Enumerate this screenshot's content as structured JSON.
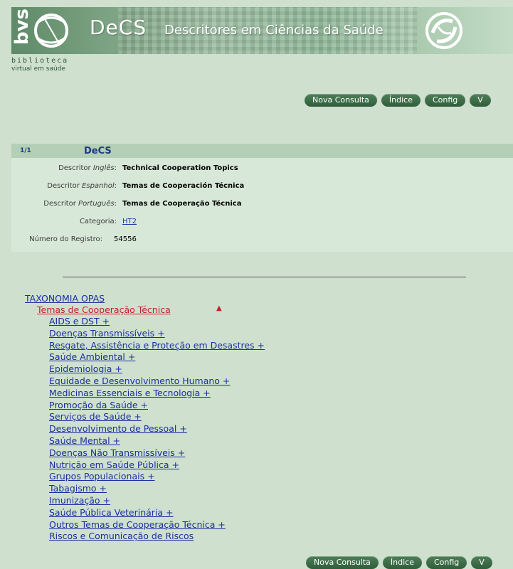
{
  "header": {
    "bvs": "bvs",
    "title": "DeCS",
    "subtitle": "Descritores em Ciências da Saúde",
    "biblioteca": "biblioteca",
    "virtual": "virtual em saúde"
  },
  "toolbar_top": {
    "nova_consulta": "Nova Consulta",
    "indice": "Índice",
    "config": "Config",
    "v": "V"
  },
  "toolbar_bottom": {
    "nova_consulta": "Nova Consulta",
    "indice": "Índice",
    "config": "Config",
    "v": "V"
  },
  "record": {
    "count": "1/1",
    "db": "DeCS",
    "descritor_ingles_prefix": "Descritor ",
    "descritor_ingles_lang": "Inglês",
    "descritor_ingles_value": "Technical Cooperation Topics",
    "descritor_espanhol_prefix": "Descritor ",
    "descritor_espanhol_lang": "Espanhol",
    "descritor_espanhol_value": "Temas de Cooperación Técnica",
    "descritor_portugues_prefix": "Descritor ",
    "descritor_portugues_lang": "Português",
    "descritor_portugues_value": "Temas de Cooperação Técnica",
    "categoria_label": "Categoria:",
    "categoria_value": "HT2",
    "registro_label": "Número do Registro:",
    "registro_value": "54556"
  },
  "tree": {
    "root": "TAXONOMIA OPAS",
    "current": "Temas de Cooperação Técnica",
    "arrow": "▲",
    "children": [
      "AIDS e DST +",
      "Doenças Transmissíveis +",
      "Resgate, Assistência e Proteção em Desastres +",
      "Saúde Ambiental +",
      "Epidemiologia +",
      "Equidade e Desenvolvimento Humano +",
      "Medicinas Essenciais e Tecnologia +",
      "Promoção da Saúde +",
      "Serviços de Saúde +",
      "Desenvolvimento de Pessoal +",
      "Saúde Mental +",
      "Doenças Não Transmissíveis +",
      "Nutrição em Saúde Pública +",
      "Grupos Populacionais +",
      "Tabagismo +",
      "Imunização +",
      "Saúde Pública Veterinária +",
      "Outros Temas de Cooperação Técnica +",
      "Riscos e Comunicação de Riscos"
    ]
  },
  "colors": {
    "background": "#cfe0cf",
    "link": "#1a2fa0",
    "current_link": "#c3202a",
    "button": "#2f5e3a"
  }
}
